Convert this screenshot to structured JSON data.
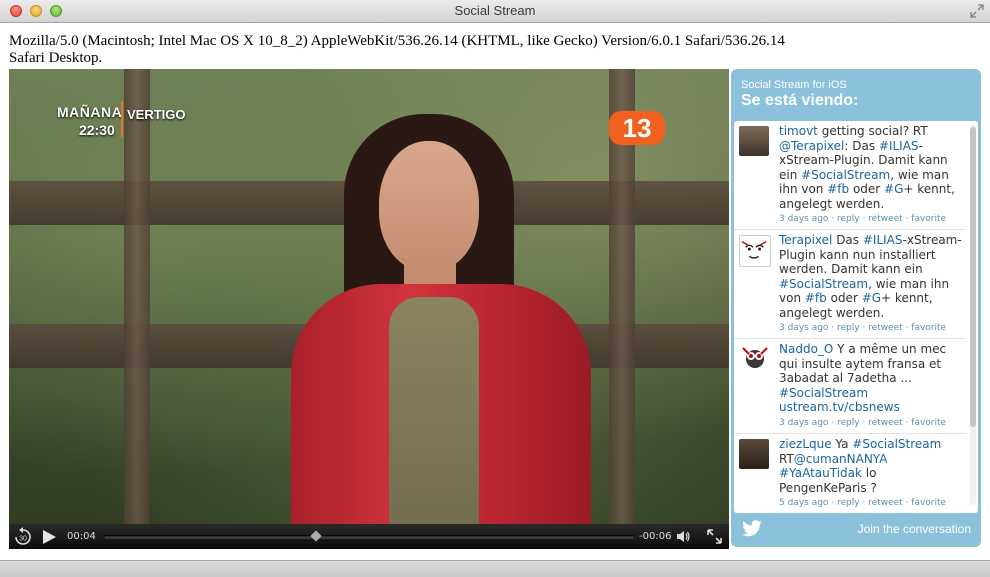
{
  "window": {
    "title": "Social Stream"
  },
  "page": {
    "ua_line": "Mozilla/5.0 (Macintosh; Intel Mac OS X 10_8_2) AppleWebKit/536.26.14 (KHTML, like Gecko) Version/6.0.1 Safari/536.26.14",
    "platform_line": "Safari Desktop."
  },
  "video": {
    "overlay_channel": "MAÑANA",
    "overlay_show": "VERTIGO",
    "overlay_time": "22:30",
    "channel_logo": "13",
    "controls": {
      "skip_back_label": "30",
      "elapsed": "00:04",
      "remaining": "-00:06",
      "progress_fraction": 0.4
    }
  },
  "widget": {
    "subtitle": "Social Stream for iOS",
    "title": "Se está viendo:",
    "footer_cta": "Join the conversation",
    "tweets": [
      {
        "user": "timovt",
        "text_a": " getting social? RT ",
        "mention": "@Terapixel",
        "text_b": ": Das ",
        "tag1": "#ILIAS",
        "text_c": "-xStream-Plugin. Damit kann ein ",
        "tag2": "#SocialStream",
        "text_d": ", wie man ihn von ",
        "tag3": "#fb",
        "text_e": " oder ",
        "tag4": "#G",
        "text_f": "+ kennt, angelegt werden.",
        "meta": "3 days ago · reply · retweet · favorite"
      },
      {
        "user": "Terapixel",
        "text_a": " Das ",
        "tag1": "#ILIAS",
        "text_b": "-xStream-Plugin kann nun installiert werden. Damit kann ein ",
        "tag2": "#SocialStream",
        "text_c": ", wie man ihn von ",
        "tag3": "#fb",
        "text_d": " oder ",
        "tag4": "#G",
        "text_e": "+ kennt, angelegt werden.",
        "meta": "3 days ago · reply · retweet · favorite"
      },
      {
        "user": "Naddo_O",
        "text_a": " Y a même un mec qui insulte aytem fransa et 3abadat al 7adetha ... ",
        "tag1": "#SocialStream",
        "link": "ustream.tv/cbsnews",
        "meta": "3 days ago · reply · retweet · favorite"
      },
      {
        "user": "ziezLque",
        "text_a": " Ya ",
        "tag1": "#SocialStream",
        "text_b": " RT",
        "mention": "@cumanNANYA",
        "tag2": "#YaAtauTidak",
        "text_c": " lo PengenKeParis ?",
        "meta": "5 days ago · reply · retweet · favorite"
      }
    ]
  },
  "colors": {
    "widget_bg": "#8cc1dc",
    "link": "#1a64a0",
    "jacket": "#c92c36",
    "channel_logo": "#f0601e"
  }
}
